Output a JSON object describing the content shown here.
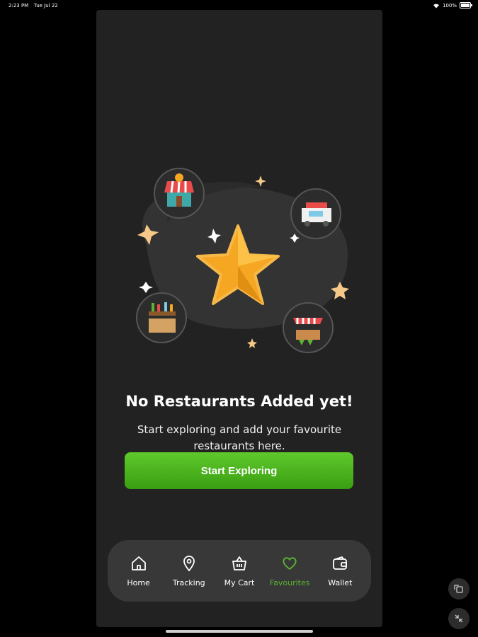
{
  "status_bar": {
    "time": "2:23 PM",
    "date": "Tue Jul 22",
    "battery": "100%"
  },
  "empty_state": {
    "title": "No Restaurants Added yet!",
    "subtitle": "Start exploring and add your favourite restaurants here.",
    "button_label": "Start Exploring"
  },
  "nav": {
    "items": [
      {
        "label": "Home",
        "icon": "home-icon",
        "active": false
      },
      {
        "label": "Tracking",
        "icon": "location-pin-icon",
        "active": false
      },
      {
        "label": "My Cart",
        "icon": "basket-icon",
        "active": false
      },
      {
        "label": "Favourites",
        "icon": "heart-icon",
        "active": true
      },
      {
        "label": "Wallet",
        "icon": "wallet-icon",
        "active": false
      }
    ]
  },
  "colors": {
    "accent": "#5cb531",
    "background": "#222222",
    "nav_background": "#383838",
    "star": "#f5a623"
  }
}
